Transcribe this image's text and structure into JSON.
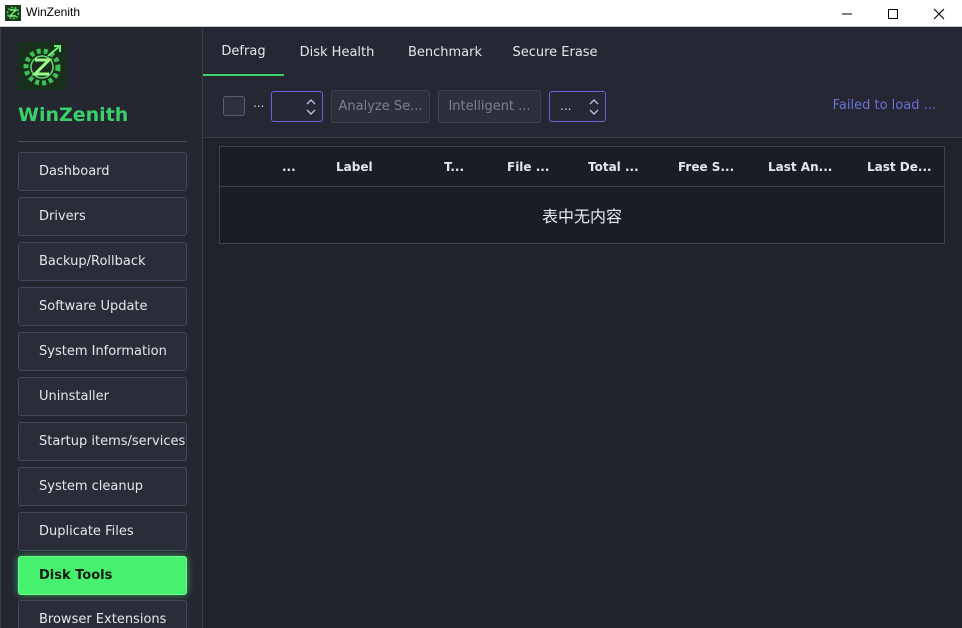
{
  "window": {
    "title": "WinZenith",
    "controls": [
      "minimize-icon",
      "maximize-icon",
      "close-icon"
    ]
  },
  "sidebar": {
    "brand": "WinZenith",
    "items": [
      {
        "label": "Dashboard"
      },
      {
        "label": "Drivers"
      },
      {
        "label": "Backup/Rollback"
      },
      {
        "label": "Software Update"
      },
      {
        "label": "System Information"
      },
      {
        "label": "Uninstaller"
      },
      {
        "label": "Startup items/services"
      },
      {
        "label": "System cleanup"
      },
      {
        "label": "Duplicate Files"
      },
      {
        "label": "Disk Tools",
        "active": true
      },
      {
        "label": "Browser Extensions"
      }
    ]
  },
  "tabs": [
    {
      "label": "Defrag",
      "active": true
    },
    {
      "label": "Disk Health"
    },
    {
      "label": "Benchmark"
    },
    {
      "label": "Secure Erase"
    }
  ],
  "toolbar": {
    "checkbox_label": "...",
    "spinner1_value": "",
    "analyze_button": "Analyze Se...",
    "intelligent_button": "Intelligent ...",
    "spinner2_value": "...",
    "status": "Failed to load ..."
  },
  "table": {
    "columns": [
      "...",
      "Label",
      "T...",
      "File ...",
      "Total ...",
      "Free S...",
      "Last An...",
      "Last De..."
    ],
    "empty_text": "表中无内容"
  },
  "colors": {
    "accent": "#3bd06a",
    "active_nav": "#47f06e",
    "status_text": "#6b70d6",
    "background": "#1f212b"
  }
}
